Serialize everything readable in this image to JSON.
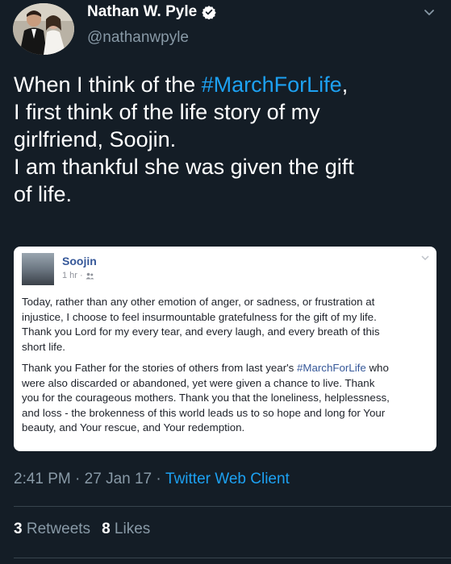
{
  "user": {
    "display_name": "Nathan W. Pyle",
    "handle": "@nathanwpyle",
    "avatar_icon": "wedding-photo-avatar",
    "verified_icon": "verified-badge-icon"
  },
  "tweet": {
    "lines": [
      {
        "pre": "When I think of the ",
        "hashtag": "#MarchForLife",
        "post": ","
      },
      {
        "text": "I first think of the life story of my"
      },
      {
        "text": "girlfriend, Soojin."
      },
      {
        "text": "I am thankful she was given the gift"
      },
      {
        "text": "of life."
      }
    ]
  },
  "embed": {
    "author": "Soojin",
    "time": "1 hr ·",
    "audience_icon": "friends-icon",
    "paragraph1_lines": [
      "Today, rather than any other emotion of anger, or sadness, or frustration at",
      "injustice, I choose to feel insurmountable gratefulness for the gift of my life.",
      "Thank you Lord for my every tear, and every laugh, and every breath of this",
      "short life."
    ],
    "paragraph2_line1_pre": "Thank you Father for the stories of others from last year's ",
    "paragraph2_line1_hashtag": "#MarchForLife",
    "paragraph2_line1_post": " who",
    "paragraph2_lines": [
      "were also discarded or abandoned, yet were given a chance to live. Thank",
      "you for the courageous mothers. Thank you that the loneliness, helplessness,",
      "and loss - the brokenness of this world leads us to so hope and long for Your",
      "beauty, and Your rescue, and Your redemption."
    ]
  },
  "footer": {
    "time": "2:41 PM",
    "sep1": " · ",
    "date": "27 Jan 17",
    "sep2": " · ",
    "client": "Twitter Web Client"
  },
  "stats": {
    "retweets_count": "3",
    "retweets_label": "Retweets",
    "likes_count": "8",
    "likes_label": "Likes"
  },
  "colors": {
    "background": "#141d26",
    "link": "#1da1f2",
    "muted": "#8899a6",
    "fb_link": "#365899"
  }
}
